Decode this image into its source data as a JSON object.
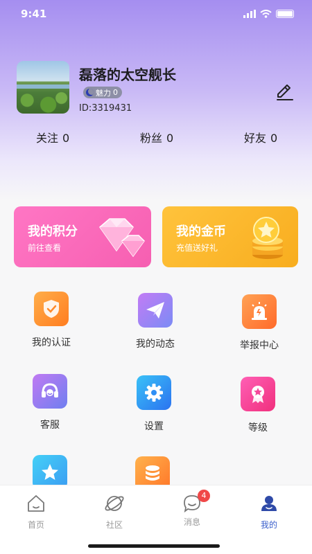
{
  "status": {
    "time": "9:41"
  },
  "profile": {
    "nickname": "磊落的太空舰长",
    "charm_label": "魅力",
    "charm_value": "0",
    "id_text": "ID:3319431"
  },
  "stats": [
    {
      "label": "关注",
      "value": "0"
    },
    {
      "label": "粉丝",
      "value": "0"
    },
    {
      "label": "好友",
      "value": "0"
    }
  ],
  "cards": {
    "points": {
      "title": "我的积分",
      "subtitle": "前往查看"
    },
    "coins": {
      "title": "我的金币",
      "subtitle": "充值送好礼"
    }
  },
  "menu": [
    {
      "label": "我的认证",
      "icon": "shield-check-icon",
      "color": "#ff8a2a"
    },
    {
      "label": "我的动态",
      "icon": "paper-plane-icon",
      "color": "#9b72f0"
    },
    {
      "label": "举报中心",
      "icon": "alarm-icon",
      "color": "#ff7a36"
    },
    {
      "label": "客服",
      "icon": "headset-icon",
      "color": "#8a6df2"
    },
    {
      "label": "设置",
      "icon": "gear-icon",
      "color": "#2f8ff5"
    },
    {
      "label": "等级",
      "icon": "medal-icon",
      "color": "#f4479a"
    },
    {
      "label": "",
      "icon": "star-icon",
      "color": "#3fb7f5"
    },
    {
      "label": "",
      "icon": "coins-stack-icon",
      "color": "#ff8d2d"
    }
  ],
  "tabs": [
    {
      "label": "首页",
      "icon": "home-icon"
    },
    {
      "label": "社区",
      "icon": "planet-icon"
    },
    {
      "label": "消息",
      "icon": "chat-icon",
      "badge": "4"
    },
    {
      "label": "我的",
      "icon": "user-icon",
      "active": true
    }
  ]
}
